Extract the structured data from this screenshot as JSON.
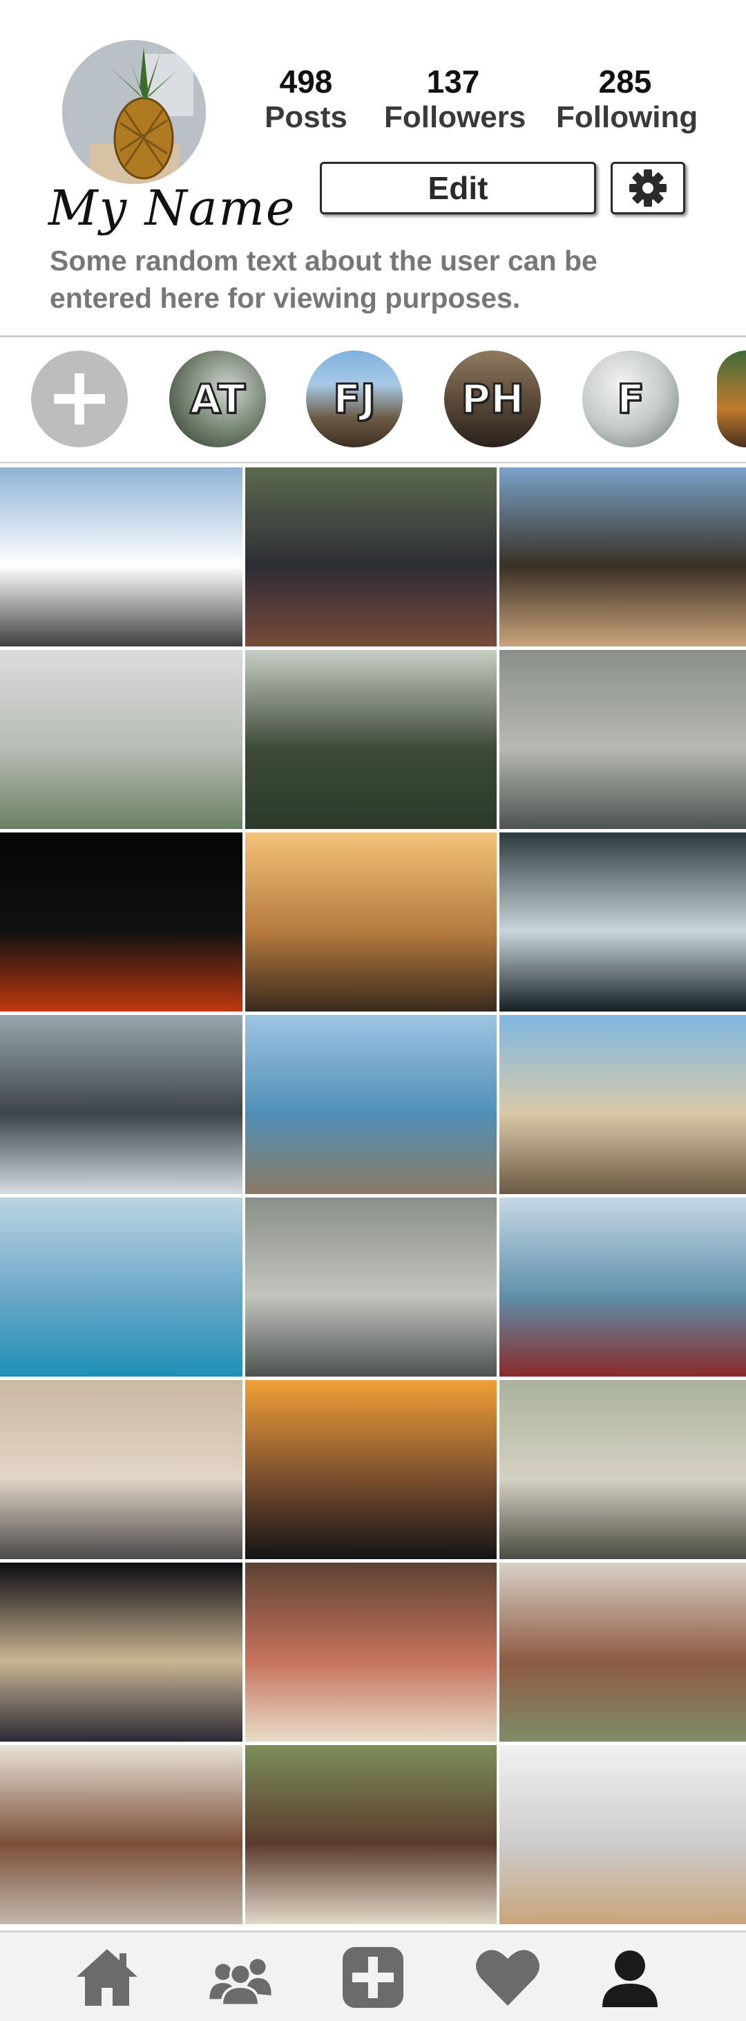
{
  "profile": {
    "name": "My Name",
    "bio": "Some random text about the user can be entered here for viewing purposes.",
    "avatar_icon": "pineapple-photo",
    "stats": [
      {
        "value": "498",
        "label": "Posts"
      },
      {
        "value": "137",
        "label": "Followers"
      },
      {
        "value": "285",
        "label": "Following"
      }
    ],
    "edit_label": "Edit",
    "settings_icon": "gear-icon"
  },
  "stories": [
    {
      "label": "AT"
    },
    {
      "label": "FJ"
    },
    {
      "label": "PH"
    },
    {
      "label": "F"
    }
  ],
  "add_story_icon": "plus-icon",
  "posts": [
    {
      "subject": "mountain sign above clouds",
      "colors": [
        "#8fb3d6",
        "#ffffff",
        "#3f3f3f"
      ]
    },
    {
      "subject": "people sitting at festival",
      "colors": [
        "#5b6a4e",
        "#2d2d36",
        "#7a4a3a"
      ]
    },
    {
      "subject": "group dancing outside hut",
      "colors": [
        "#7aa3c9",
        "#3a3026",
        "#c9a37a"
      ]
    },
    {
      "subject": "misty forest",
      "colors": [
        "#dcdcdc",
        "#b7bcb5",
        "#6b8062"
      ]
    },
    {
      "subject": "a-frame cabin in mist",
      "colors": [
        "#c8cec4",
        "#3d4a3a",
        "#2b3a2a"
      ]
    },
    {
      "subject": "girl in hat on boat",
      "colors": [
        "#8b8f8a",
        "#b6b9b2",
        "#4d5350"
      ]
    },
    {
      "subject": "campfire at night",
      "colors": [
        "#050505",
        "#111",
        "#c0380f"
      ]
    },
    {
      "subject": "sunset behind truck",
      "colors": [
        "#f3c37a",
        "#b67a3e",
        "#3a2b1e"
      ]
    },
    {
      "subject": "waterfall",
      "colors": [
        "#2c3a3e",
        "#c8d6da",
        "#152024"
      ]
    },
    {
      "subject": "car side mirror",
      "colors": [
        "#9aa6ad",
        "#3c444a",
        "#d5dde1"
      ]
    },
    {
      "subject": "sea shallows",
      "colors": [
        "#9fc4e3",
        "#4f8fb7",
        "#8a7a63"
      ]
    },
    {
      "subject": "book in hammock by beach",
      "colors": [
        "#7fb7e3",
        "#d9c9a8",
        "#6b5a44"
      ]
    },
    {
      "subject": "ocean horizon",
      "colors": [
        "#bcd4e2",
        "#6aa7c8",
        "#1e8fb6"
      ]
    },
    {
      "subject": "girl in hat on boat",
      "colors": [
        "#8b8f8a",
        "#c2c4bf",
        "#4d5350"
      ]
    },
    {
      "subject": "pool and laptop",
      "colors": [
        "#c6d8e6",
        "#5f8fa9",
        "#8a2a2a"
      ]
    },
    {
      "subject": "girl with laptop",
      "colors": [
        "#c9b9a2",
        "#e2d4c6",
        "#4a4a4a"
      ]
    },
    {
      "subject": "tropical sunset",
      "colors": [
        "#f2a037",
        "#7a4e2e",
        "#141414"
      ]
    },
    {
      "subject": "woman by stream",
      "colors": [
        "#a9b29a",
        "#d5d1c4",
        "#4b4b41"
      ]
    },
    {
      "subject": "airplane cabin",
      "colors": [
        "#0c0c12",
        "#c9b592",
        "#2a2a35"
      ]
    },
    {
      "subject": "smoothie bowl",
      "colors": [
        "#5c4232",
        "#c7735d",
        "#e7dcc7"
      ]
    },
    {
      "subject": "smoothie bowl in hand",
      "colors": [
        "#d8d0c6",
        "#8e5a43",
        "#7e8c6a"
      ]
    },
    {
      "subject": "smoothie bowl with candle",
      "colors": [
        "#e9e3d7",
        "#7b4f3a",
        "#c2b8a9"
      ]
    },
    {
      "subject": "smoothie bowl with leaves",
      "colors": [
        "#7b8f5a",
        "#5b3b2c",
        "#e1d8c6"
      ]
    },
    {
      "subject": "magazine page",
      "colors": [
        "#f1f1f1",
        "#cccccc",
        "#c9a57a"
      ]
    }
  ],
  "nav": [
    {
      "name": "home-icon"
    },
    {
      "name": "people-icon"
    },
    {
      "name": "add-post-icon"
    },
    {
      "name": "heart-icon"
    },
    {
      "name": "profile-icon"
    }
  ]
}
